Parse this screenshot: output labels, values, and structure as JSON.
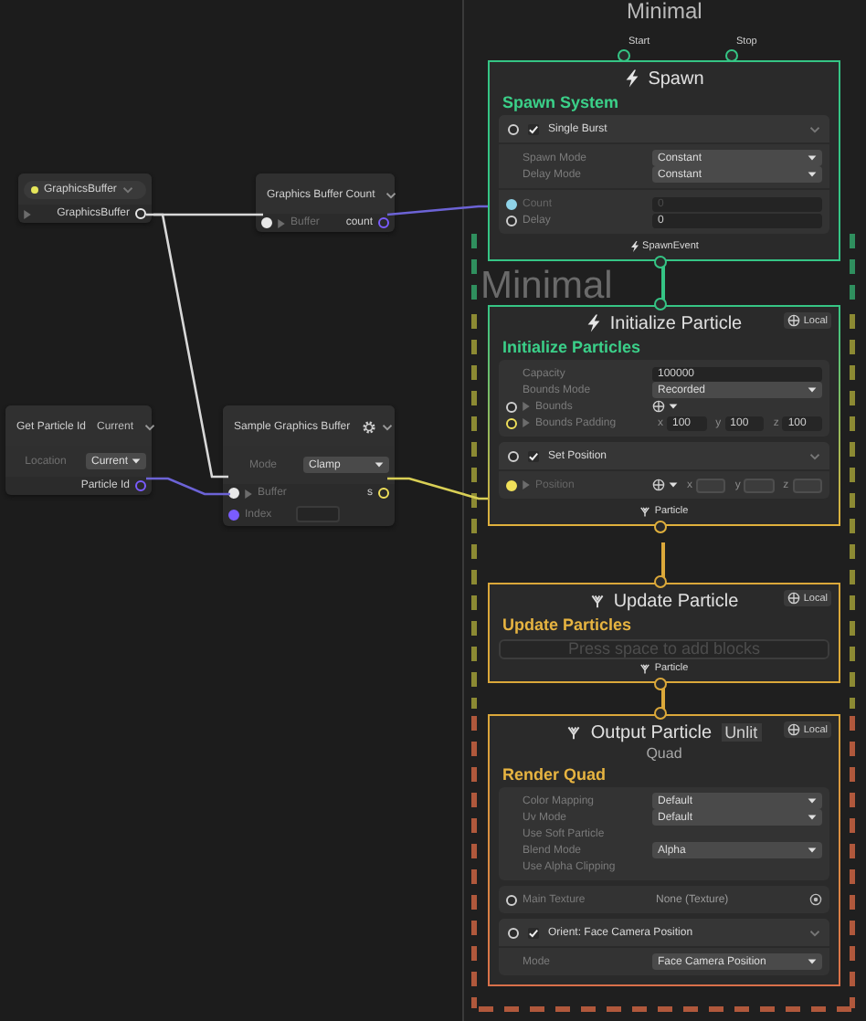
{
  "graph_title": "Minimal",
  "system_label": "Minimal",
  "operators": [
    {
      "kind": "parameter",
      "title": "GraphicsBuffer",
      "color": "#e6e65a",
      "rows": [
        {
          "kind": "output",
          "label": "GraphicsBuffer",
          "color": "#e8e8e8"
        }
      ]
    },
    {
      "kind": "operator",
      "title": "Graphics Buffer Count",
      "rows": [
        {
          "kind": "in-out",
          "input": {
            "label": "Buffer",
            "color": "#e8e8e8"
          },
          "output": {
            "label": "count",
            "color": "#7a5cff"
          }
        }
      ]
    },
    {
      "kind": "operator",
      "title": "Get Particle Id",
      "mode": "Current",
      "rows": [
        {
          "kind": "setting",
          "label": "Location",
          "value": "Current"
        },
        {
          "kind": "output",
          "label": "Particle Id",
          "color": "#7a5cff"
        }
      ]
    },
    {
      "kind": "operator",
      "title": "Sample Graphics Buffer",
      "has_settings": true,
      "rows": [
        {
          "kind": "setting",
          "label": "Mode",
          "value": "Clamp"
        },
        {
          "kind": "in-out",
          "input": {
            "label": "Buffer",
            "color": "#e8e8e8"
          },
          "output": {
            "label": "s",
            "color": "#f0e05a"
          }
        },
        {
          "kind": "input",
          "label": "Index",
          "color": "#7a5cff"
        }
      ]
    }
  ],
  "contexts": [
    {
      "kind": "spawn",
      "title": "Spawn",
      "heading": "Spawn System",
      "top_ports": [
        "Start",
        "Stop"
      ],
      "sections": [
        {
          "kind": "block",
          "title": "Single Burst",
          "checked": true,
          "rows": [
            {
              "kind": "dropdown",
              "label": "Spawn Mode",
              "value": "Constant"
            },
            {
              "kind": "dropdown",
              "label": "Delay Mode",
              "value": "Constant"
            },
            {
              "kind": "field",
              "label": "Count",
              "value": "0",
              "connected": true,
              "color": "#8fd3e8"
            },
            {
              "kind": "field",
              "label": "Delay",
              "value": "0",
              "connected": false,
              "color": "#cfcfcf"
            }
          ]
        }
      ],
      "footer": "SpawnEvent"
    },
    {
      "kind": "initialize",
      "title": "Initialize Particle",
      "space": "Local",
      "heading": "Initialize Particles",
      "sections": [
        {
          "kind": "panel",
          "rows": [
            {
              "kind": "text",
              "label": "Capacity",
              "value": "100000"
            },
            {
              "kind": "dropdown",
              "label": "Bounds Mode",
              "value": "Recorded"
            },
            {
              "kind": "space",
              "label": "Bounds",
              "connected": false,
              "color": "#cfcfcf"
            },
            {
              "kind": "vector",
              "label": "Bounds Padding",
              "connected": false,
              "color": "#f0e05a",
              "components": [
                {
                  "axis": "x",
                  "value": "100"
                },
                {
                  "axis": "y",
                  "value": "100"
                },
                {
                  "axis": "z",
                  "value": "100"
                }
              ]
            }
          ]
        },
        {
          "kind": "block",
          "title": "Set Position",
          "checked": true,
          "rows": [
            {
              "kind": "vector",
              "label": "Position",
              "space": true,
              "connected": true,
              "color": "#f0e05a",
              "components": [
                {
                  "axis": "x"
                },
                {
                  "axis": "y"
                },
                {
                  "axis": "z"
                }
              ]
            }
          ]
        }
      ],
      "footer": "Particle"
    },
    {
      "kind": "update",
      "title": "Update Particle",
      "space": "Local",
      "heading": "Update Particles",
      "placeholder": "Press space to add blocks",
      "footer": "Particle"
    },
    {
      "kind": "output",
      "title": "Output Particle",
      "title_tag": "Unlit",
      "subtitle": "Quad",
      "space": "Local",
      "heading": "Render Quad",
      "sections": [
        {
          "kind": "panel",
          "rows": [
            {
              "kind": "dropdown",
              "label": "Color Mapping",
              "value": "Default"
            },
            {
              "kind": "dropdown",
              "label": "Uv Mode",
              "value": "Default"
            },
            {
              "kind": "label",
              "label": "Use Soft Particle"
            },
            {
              "kind": "dropdown",
              "label": "Blend Mode",
              "value": "Alpha"
            },
            {
              "kind": "label",
              "label": "Use Alpha Clipping"
            }
          ]
        },
        {
          "kind": "panel",
          "rows": [
            {
              "kind": "object",
              "label": "Main Texture",
              "value": "None (Texture)",
              "connected": false,
              "color": "#cfcfcf"
            }
          ]
        },
        {
          "kind": "block",
          "title": "Orient: Face Camera Position",
          "checked": true,
          "rows": [
            {
              "kind": "dropdown",
              "label": "Mode",
              "value": "Face Camera Position"
            }
          ]
        }
      ]
    }
  ]
}
